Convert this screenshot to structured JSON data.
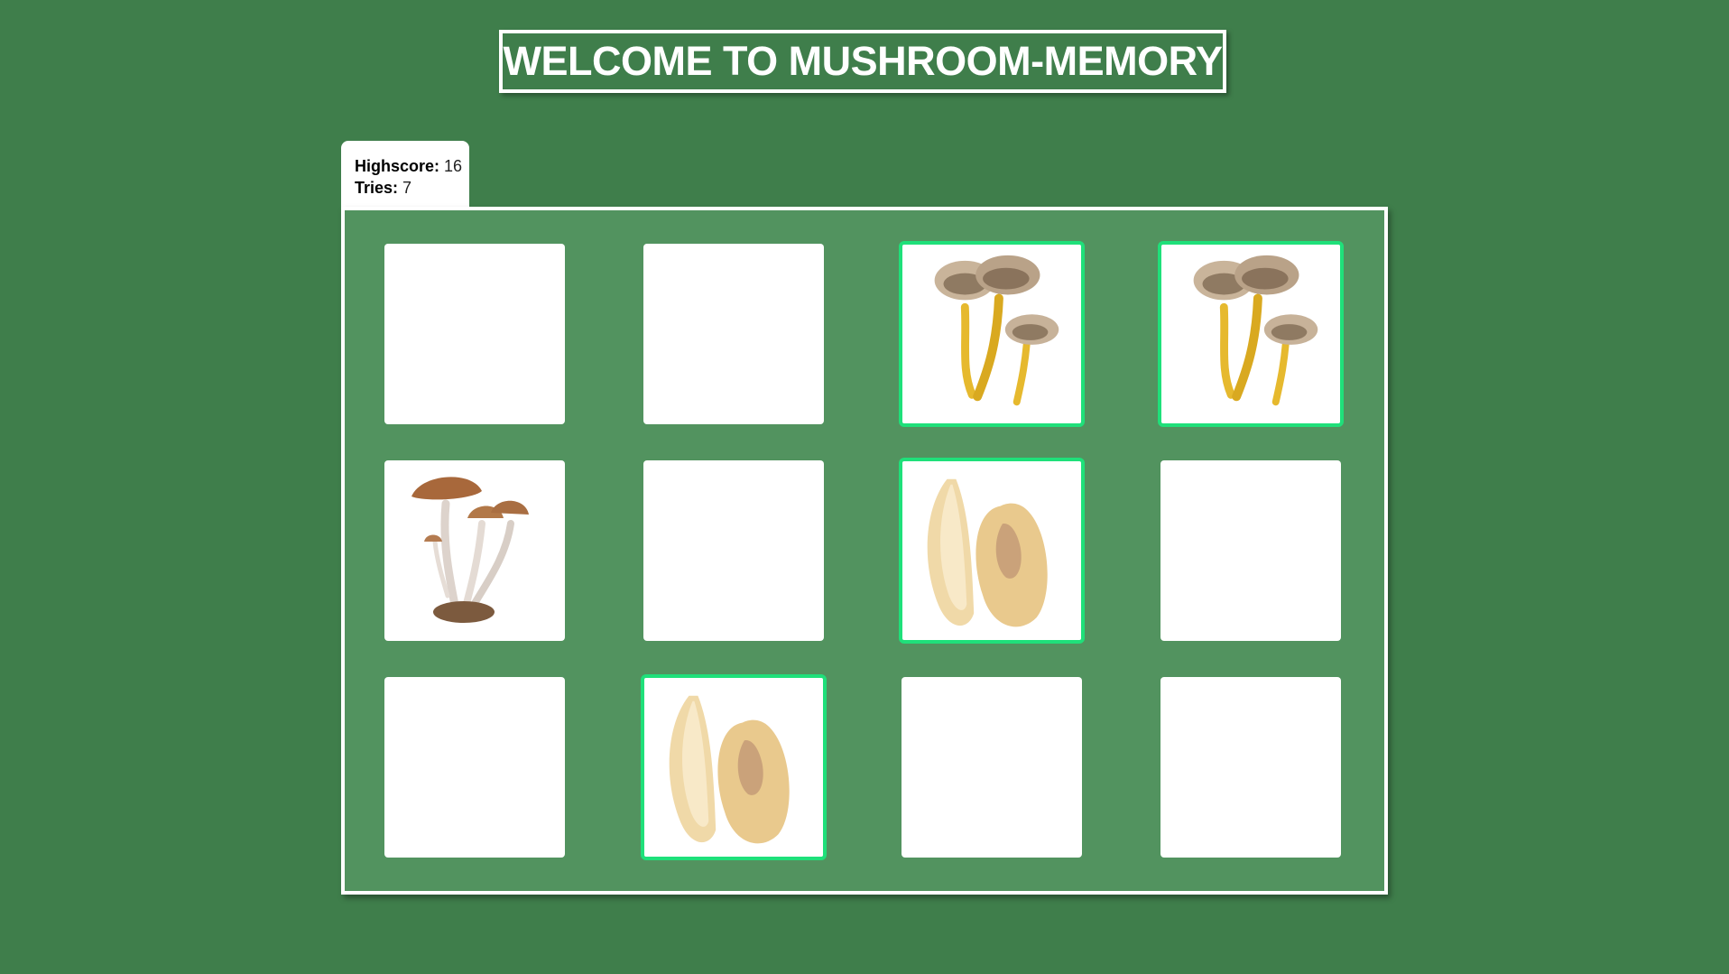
{
  "title": "WELCOME TO MUSHROOM-MEMORY",
  "stats": {
    "highscore_label": "Highscore:",
    "highscore_value": "16",
    "tries_label": "Tries:",
    "tries_value": "7"
  },
  "colors": {
    "background": "#3f7e4b",
    "board": "#52935f",
    "matched_border": "#1fe07a",
    "card_back": "#ffffff"
  },
  "cards": [
    {
      "state": "hidden",
      "image": ""
    },
    {
      "state": "hidden",
      "image": ""
    },
    {
      "state": "matched",
      "image": "chanterelle-icon"
    },
    {
      "state": "matched",
      "image": "chanterelle-icon"
    },
    {
      "state": "revealed",
      "image": "honey-mushroom-icon"
    },
    {
      "state": "hidden",
      "image": ""
    },
    {
      "state": "matched",
      "image": "cup-fungus-icon"
    },
    {
      "state": "hidden",
      "image": ""
    },
    {
      "state": "hidden",
      "image": ""
    },
    {
      "state": "matched",
      "image": "cup-fungus-icon"
    },
    {
      "state": "hidden",
      "image": ""
    },
    {
      "state": "hidden",
      "image": ""
    }
  ]
}
